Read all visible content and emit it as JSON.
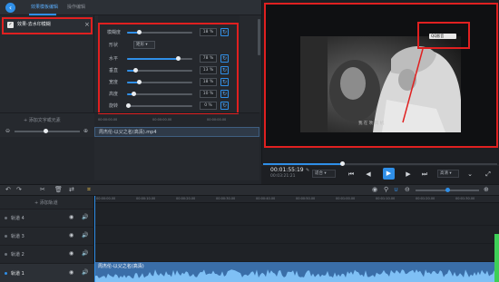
{
  "tabs": [
    {
      "label": "效果模板编辑",
      "active": true
    },
    {
      "label": "操作编辑",
      "active": false
    }
  ],
  "effect_list": {
    "item_label": "效果-去水印模糊",
    "checked": true
  },
  "params": {
    "rows": [
      {
        "label": "模糊度",
        "value": "18 %",
        "fraction": 0.18
      },
      {
        "label": "形状",
        "select": "矩形"
      },
      {
        "label": "水平",
        "value": "78 %",
        "fraction": 0.78
      },
      {
        "label": "垂直",
        "value": "13 %",
        "fraction": 0.13
      },
      {
        "label": "宽度",
        "value": "18 %",
        "fraction": 0.18
      },
      {
        "label": "高度",
        "value": "10 %",
        "fraction": 0.1
      },
      {
        "label": "旋转",
        "value": "0 %",
        "fraction": 0.0
      }
    ]
  },
  "subtitle": {
    "add_label": "+ 添加文字或元素"
  },
  "source_ruler": [
    "00:00:00.00",
    "00:00:00.00",
    "00:00:00.00"
  ],
  "source_clip": {
    "label": "周杰伦-以父之名(高清).mp4"
  },
  "preview": {
    "caption": "我 在 吹 风 机",
    "watermark_text": "QQ影音"
  },
  "player": {
    "current_time": "00:01:55:19",
    "total_time": "00:03:21:21",
    "progress": 0.34,
    "ratio_select": "适合",
    "quality_select": "高清",
    "accent": "#2f8fe8"
  },
  "timeline": {
    "add_track_label": "+ 添加轨道",
    "ruler_ticks": [
      "00:00:00.00",
      "00:00:10.00",
      "00:00:20.00",
      "00:00:30.00",
      "00:00:40.00",
      "00:00:50.00",
      "00:01:00.00",
      "00:01:10.00",
      "00:01:20.00",
      "00:01:30.00"
    ],
    "tracks": [
      {
        "name": "轨道 4"
      },
      {
        "name": "轨道 3"
      },
      {
        "name": "轨道 2"
      },
      {
        "name": "轨道 1"
      }
    ],
    "audio_clip_label": "周杰伦-以父之名(高清)"
  }
}
